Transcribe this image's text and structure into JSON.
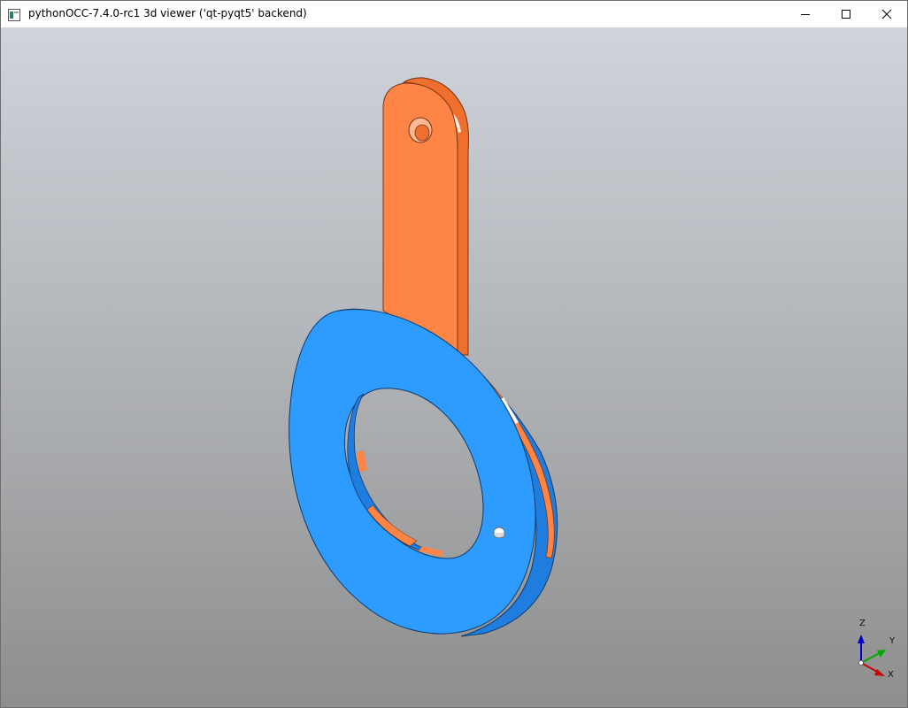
{
  "window": {
    "title": "pythonOCC-7.4.0-rc1 3d viewer ('qt-pyqt5' backend)",
    "icons": {
      "app": "app-window-icon",
      "minimize": "minimize-icon",
      "maximize": "maximize-icon",
      "close": "close-icon"
    }
  },
  "viewer": {
    "background": {
      "top": "#cfd4db",
      "bottom": "#8e8e8e"
    },
    "model": {
      "parts": [
        {
          "name": "tab",
          "color": "#ff8547",
          "shade": "#ef6f2e"
        },
        {
          "name": "ring",
          "color": "#2e9bff",
          "shade": "#1f7de0"
        }
      ]
    },
    "triedron": {
      "z_label": "Z",
      "y_label": "Y",
      "x_label": "X",
      "colors": {
        "z": "#0000cc",
        "y": "#00aa00",
        "x": "#cc0000"
      }
    }
  }
}
